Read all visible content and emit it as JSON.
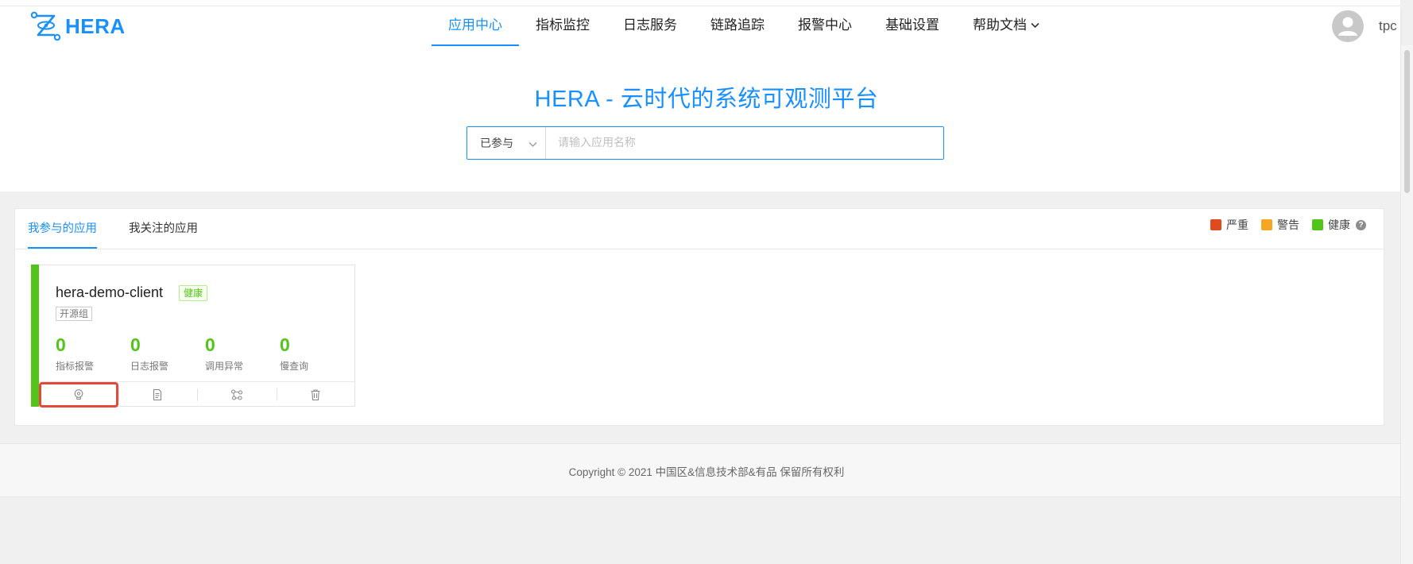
{
  "brand": {
    "name": "HERA"
  },
  "nav": {
    "items": [
      {
        "label": "应用中心",
        "active": true
      },
      {
        "label": "指标监控",
        "active": false
      },
      {
        "label": "日志服务",
        "active": false
      },
      {
        "label": "链路追踪",
        "active": false
      },
      {
        "label": "报警中心",
        "active": false
      },
      {
        "label": "基础设置",
        "active": false
      },
      {
        "label": "帮助文档",
        "active": false,
        "dropdown": true
      }
    ]
  },
  "user": {
    "name": "tpc",
    "avatar_icon": "user-avatar-icon"
  },
  "hero": {
    "title": "HERA - 云时代的系统可观测平台",
    "search": {
      "filter_value": "已参与",
      "placeholder": "请输入应用名称",
      "value": ""
    }
  },
  "apps_panel": {
    "tabs": [
      {
        "label": "我参与的应用",
        "active": true
      },
      {
        "label": "我关注的应用",
        "active": false
      }
    ],
    "legend": [
      {
        "label": "严重",
        "color": "#e04a1f"
      },
      {
        "label": "警告",
        "color": "#f5a623"
      },
      {
        "label": "健康",
        "color": "#52c41a"
      }
    ],
    "apps": [
      {
        "name": "hera-demo-client",
        "status": "健康",
        "status_color": "#52c41a",
        "group": "开源组",
        "metrics": [
          {
            "value": "0",
            "label": "指标报警"
          },
          {
            "value": "0",
            "label": "日志报警"
          },
          {
            "value": "0",
            "label": "调用异常"
          },
          {
            "value": "0",
            "label": "慢查询"
          }
        ],
        "actions": [
          {
            "icon": "alarm-bulb-icon",
            "highlighted": true
          },
          {
            "icon": "document-icon",
            "highlighted": false
          },
          {
            "icon": "trace-icon",
            "highlighted": false
          },
          {
            "icon": "trash-icon",
            "highlighted": false
          }
        ]
      }
    ]
  },
  "footer": {
    "copyright": "Copyright © 2021 中国区&信息技术部&有品 保留所有权利"
  }
}
